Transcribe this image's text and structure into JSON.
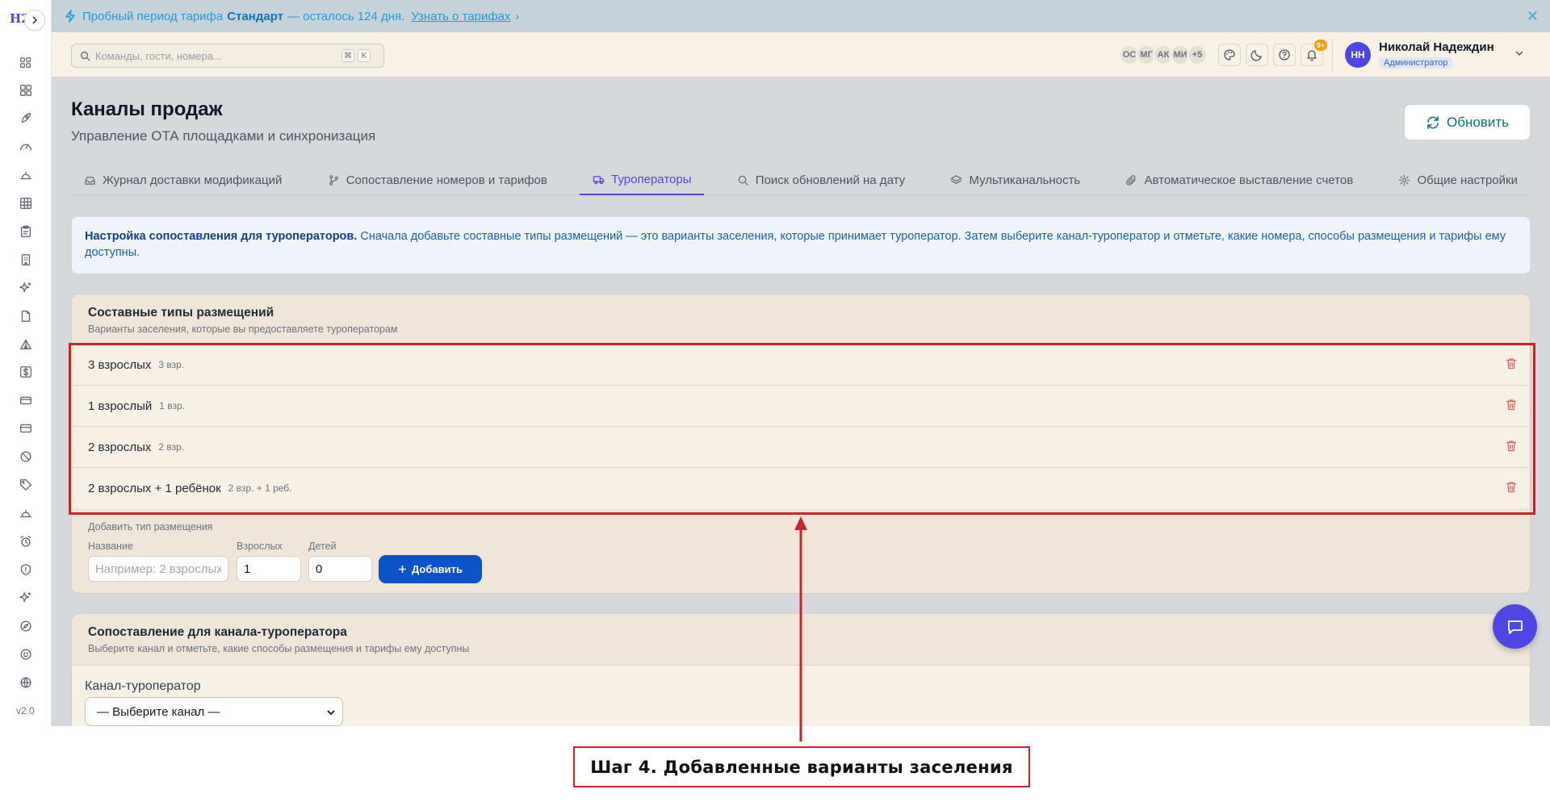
{
  "banner": {
    "prefix": "Пробный период тарифа",
    "plan": "Стандарт",
    "suffix": "— осталось 124 дня.",
    "link": "Узнать о тарифах",
    "link_arrow": "›",
    "close": "✕"
  },
  "sidebar": {
    "logo": "H2",
    "toggle": "›",
    "version": "v2.0",
    "icons": [
      "dashboard-icon",
      "grid-icon",
      "rocket-icon",
      "gauge-icon",
      "bell-service-icon",
      "table-icon",
      "clipboard-icon",
      "building-icon",
      "sparkles-icon",
      "file-icon",
      "tent-icon",
      "dollar-icon",
      "card-icon",
      "wallet-icon",
      "ban-icon",
      "tag-icon",
      "service-bell-icon",
      "alarm-icon",
      "shield-icon",
      "sparkle-icon",
      "compass-icon",
      "smile-icon",
      "globe-icon"
    ]
  },
  "header": {
    "search_placeholder": "Команды, гости, номера...",
    "shortcut_mod": "⌘",
    "shortcut_key": "K",
    "avatars": [
      "ОС",
      "МГ",
      "АК",
      "МИ",
      "+5"
    ],
    "notif_badge": "9+",
    "user_initials": "НН",
    "user_name": "Николай Надеждин",
    "user_role": "Администратор"
  },
  "page": {
    "title": "Каналы продаж",
    "subtitle": "Управление ОТА площадками и синхронизация",
    "refresh": "Обновить"
  },
  "tabs": [
    {
      "label": "Журнал доставки модификаций",
      "icon": "inbox-icon",
      "active": false
    },
    {
      "label": "Сопоставление номеров и тарифов",
      "icon": "git-branch-icon",
      "active": false
    },
    {
      "label": "Туроператоры",
      "icon": "truck-icon",
      "active": true
    },
    {
      "label": "Поиск обновлений на дату",
      "icon": "search-icon",
      "active": false
    },
    {
      "label": "Мультиканальность",
      "icon": "layers-icon",
      "active": false
    },
    {
      "label": "Автоматическое выставление счетов",
      "icon": "paperclip-icon",
      "active": false
    },
    {
      "label": "Общие настройки",
      "icon": "gear-icon",
      "active": false
    }
  ],
  "info": {
    "bold": "Настройка сопоставления для туроператоров.",
    "text": "Сначала добавьте составные типы размещений — это варианты заселения, которые принимает туроператор. Затем выберите канал-туроператор и отметьте, какие номера, способы размещения и тарифы ему доступны."
  },
  "types_card": {
    "title": "Составные типы размещений",
    "subtitle": "Варианты заселения, которые вы предоставляете туроператорам",
    "rows": [
      {
        "name": "3 взрослых",
        "short": "3 взр."
      },
      {
        "name": "1 взрослый",
        "short": "1 взр."
      },
      {
        "name": "2 взрослых",
        "short": "2 взр."
      },
      {
        "name": "2 взрослых + 1 ребёнок",
        "short": "2 взр. + 1 реб."
      }
    ],
    "add_title": "Добавить тип размещения",
    "name_label": "Название",
    "name_placeholder": "Например: 2 взрослых",
    "adults_label": "Взрослых",
    "adults_value": "1",
    "children_label": "Детей",
    "children_value": "0",
    "add_button": "Добавить"
  },
  "map_card": {
    "title": "Сопоставление для канала-туроператора",
    "subtitle": "Выберите канал и отметьте, какие способы размещения и тарифы ему доступны",
    "channel_label": "Канал-туроператор",
    "channel_value": "— Выберите канал —"
  },
  "annotation": {
    "caption": "Шаг 4. Добавленные варианты заселения",
    "color": "#d0202a"
  }
}
